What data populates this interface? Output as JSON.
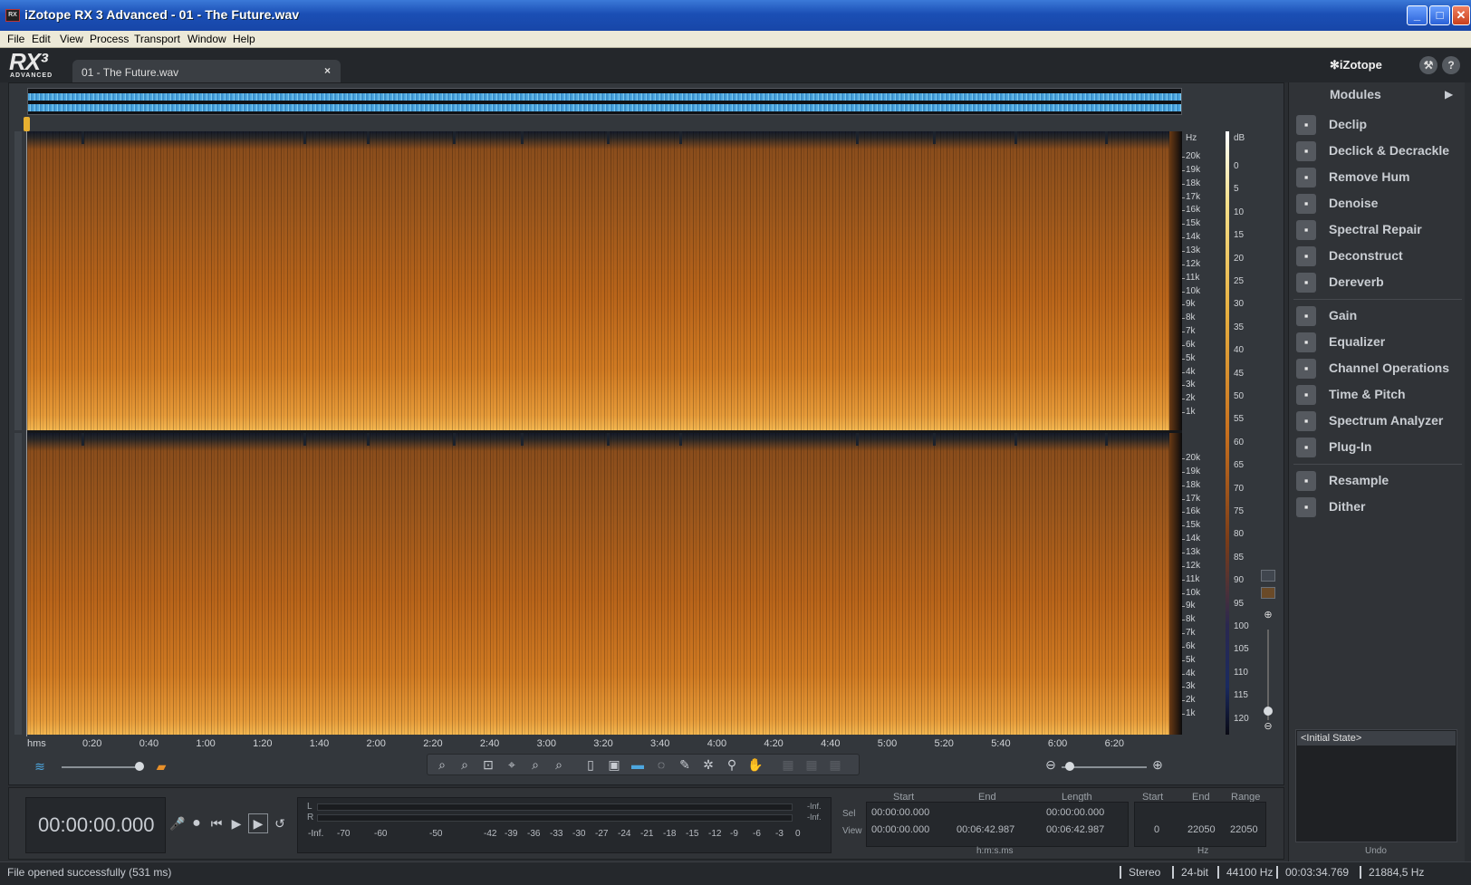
{
  "window": {
    "title": "iZotope RX 3 Advanced - 01 - The Future.wav",
    "app_icon": "RX"
  },
  "menu": [
    "File",
    "Edit",
    "View",
    "Process",
    "Transport",
    "Window",
    "Help"
  ],
  "header": {
    "logo": "RX³",
    "logo_sub": "ADVANCED",
    "file_tab": "01 - The Future.wav",
    "brand": "iZotope",
    "settings_icon": "wrench-icon",
    "help_label": "?"
  },
  "hz_labels": [
    "Hz",
    "20k",
    "19k",
    "18k",
    "17k",
    "16k",
    "15k",
    "14k",
    "13k",
    "12k",
    "11k",
    "10k",
    "9k",
    "8k",
    "7k",
    "6k",
    "5k",
    "4k",
    "3k",
    "2k",
    "1k"
  ],
  "db_labels": [
    "dB",
    "0",
    "5",
    "10",
    "15",
    "20",
    "25",
    "30",
    "35",
    "40",
    "45",
    "50",
    "55",
    "60",
    "65",
    "70",
    "75",
    "80",
    "85",
    "90",
    "95",
    "100",
    "105",
    "110",
    "115",
    "120"
  ],
  "time_labels": [
    "hms",
    "0:20",
    "0:40",
    "1:00",
    "1:20",
    "1:40",
    "2:00",
    "2:20",
    "2:40",
    "3:00",
    "3:20",
    "3:40",
    "4:00",
    "4:20",
    "4:40",
    "5:00",
    "5:20",
    "5:40",
    "6:00",
    "6:20"
  ],
  "modules": {
    "header": "Modules",
    "groups": [
      [
        {
          "label": "Declip",
          "icon": "declip-icon"
        },
        {
          "label": "Declick & Decrackle",
          "icon": "declick-icon"
        },
        {
          "label": "Remove Hum",
          "icon": "hum-icon"
        },
        {
          "label": "Denoise",
          "icon": "denoise-icon"
        },
        {
          "label": "Spectral Repair",
          "icon": "spectral-repair-icon"
        },
        {
          "label": "Deconstruct",
          "icon": "deconstruct-icon"
        },
        {
          "label": "Dereverb",
          "icon": "dereverb-icon"
        }
      ],
      [
        {
          "label": "Gain",
          "icon": "gain-icon"
        },
        {
          "label": "Equalizer",
          "icon": "equalizer-icon"
        },
        {
          "label": "Channel Operations",
          "icon": "channel-ops-icon"
        },
        {
          "label": "Time & Pitch",
          "icon": "time-pitch-icon"
        },
        {
          "label": "Spectrum Analyzer",
          "icon": "spectrum-icon"
        },
        {
          "label": "Plug-In",
          "icon": "plugin-icon"
        }
      ],
      [
        {
          "label": "Resample",
          "icon": "resample-icon"
        },
        {
          "label": "Dither",
          "icon": "dither-icon"
        }
      ]
    ]
  },
  "undo": {
    "items": [
      "<Initial State>"
    ],
    "label": "Undo"
  },
  "transport": {
    "time": "00:00:00.000"
  },
  "meter": {
    "channels": [
      "L",
      "R"
    ],
    "inf": [
      "-Inf.",
      "-Inf."
    ],
    "scale": [
      "-Inf.",
      "-70",
      "-60",
      "-50",
      "-42",
      "-39",
      "-36",
      "-33",
      "-30",
      "-27",
      "-24",
      "-21",
      "-18",
      "-15",
      "-12",
      "-9",
      "-6",
      "-3",
      "0"
    ]
  },
  "selection": {
    "headers": {
      "start": "Start",
      "end": "End",
      "length": "Length",
      "hz_start": "Start",
      "hz_end": "End",
      "range": "Range"
    },
    "rows": {
      "sel": "Sel",
      "view": "View"
    },
    "sel_start": "00:00:00.000",
    "sel_end": "",
    "sel_length": "00:00:00.000",
    "view_start": "00:00:00.000",
    "view_end": "00:06:42.987",
    "view_length": "00:06:42.987",
    "hz_start": "0",
    "hz_end": "22050",
    "hz_range": "22050",
    "unit_time": "h:m:s.ms",
    "unit_hz": "Hz"
  },
  "status": {
    "message": "File opened successfully (531 ms)",
    "segments": [
      "Stereo",
      "24-bit",
      "44100 Hz",
      "00:03:34.769",
      "21884,5 Hz"
    ]
  }
}
